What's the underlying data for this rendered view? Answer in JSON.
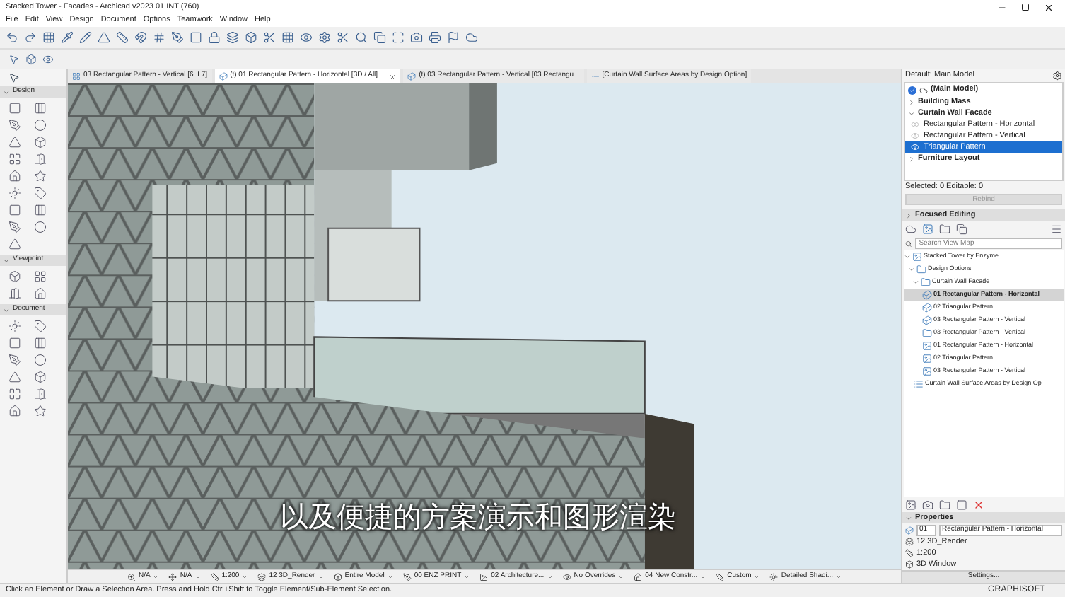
{
  "window": {
    "title": "Stacked Tower - Facades - Archicad v2023 01 INT (760)"
  },
  "menu": [
    "File",
    "Edit",
    "View",
    "Design",
    "Document",
    "Options",
    "Teamwork",
    "Window",
    "Help"
  ],
  "tabs": [
    {
      "label": "03 Rectangular Pattern - Vertical [6. L7]",
      "kind": "plan",
      "selected": false
    },
    {
      "label": "(t) 01 Rectangular Pattern - Horizontal [3D / All]",
      "kind": "view3d",
      "selected": true
    },
    {
      "label": "(t) 03 Rectangular Pattern - Vertical [03 Rectangu...",
      "kind": "view3d",
      "selected": false
    },
    {
      "label": "[Curtain Wall Surface Areas by Design Option]",
      "kind": "list",
      "selected": false
    }
  ],
  "toolbox": [
    {
      "title": "Design",
      "expanded": true
    },
    {
      "title": "Viewpoint",
      "expanded": true
    },
    {
      "title": "Document",
      "expanded": true
    }
  ],
  "subtitle": "以及便捷的方案演示和图形渲染",
  "view_bar": {
    "items": [
      {
        "label": "N/A",
        "kind": "zoom"
      },
      {
        "label": "N/A",
        "kind": "angle"
      },
      {
        "label": "1:200",
        "kind": "scale"
      },
      {
        "label": "12 3D_Render",
        "kind": "layers"
      },
      {
        "label": "Entire Model",
        "kind": "model"
      },
      {
        "label": "00 ENZ PRINT",
        "kind": "pen"
      },
      {
        "label": "02 Architecture...",
        "kind": "graphic"
      },
      {
        "label": "No Overrides",
        "kind": "override"
      },
      {
        "label": "04 New Constr...",
        "kind": "phase"
      },
      {
        "label": "Custom",
        "kind": "dimension"
      },
      {
        "label": "Detailed Shadi...",
        "kind": "shading"
      }
    ]
  },
  "status_bar": {
    "text": "Click an Element or Draw a Selection Area. Press and Hold Ctrl+Shift to Toggle Element/Sub-Element Selection.",
    "brand": "GRAPHISOFT"
  },
  "design_options": {
    "default": "Default: Main Model",
    "main": {
      "label": "(Main Model)",
      "checked": true
    },
    "sets": [
      {
        "label": "Building Mass",
        "expanded": false
      },
      {
        "label": "Curtain Wall Facade",
        "expanded": true,
        "options": [
          {
            "label": "Rectangular Pattern - Horizontal",
            "selected": false
          },
          {
            "label": "Rectangular Pattern - Vertical",
            "selected": false
          },
          {
            "label": "Triangular Pattern",
            "selected": true
          }
        ]
      },
      {
        "label": "Furniture Layout",
        "expanded": false
      }
    ],
    "selection": "Selected: 0 Editable: 0",
    "rebind": {
      "label": "Rebind",
      "disabled": true
    },
    "focused_editing": {
      "label": "Focused Editing",
      "expanded": false
    }
  },
  "navigator": {
    "search": {
      "placeholder": "Search View Map"
    },
    "tree": [
      {
        "label": "Stacked Tower by Enzyme",
        "kind": "project",
        "expanded": true,
        "selected": false,
        "children": [
          {
            "label": "Design Options",
            "kind": "folder",
            "expanded": true,
            "selected": false,
            "children": [
              {
                "label": "Curtain Wall Facade",
                "kind": "folder",
                "expanded": true,
                "selected": false,
                "children": [
                  {
                    "label": "01 Rectangular Pattern - Horizontal",
                    "kind": "view3d",
                    "selected": true
                  },
                  {
                    "label": "02 Triangular Pattern",
                    "kind": "view3d",
                    "selected": false
                  },
                  {
                    "label": "03 Rectangular Pattern - Vertical",
                    "kind": "view3d",
                    "selected": false
                  },
                  {
                    "label": "03 Rectangular Pattern - Vertical",
                    "kind": "folder",
                    "selected": false
                  },
                  {
                    "label": "01 Rectangular Pattern - Horizontal",
                    "kind": "elevation",
                    "selected": false
                  },
                  {
                    "label": "02 Triangular Pattern",
                    "kind": "elevation",
                    "selected": false
                  },
                  {
                    "label": "03 Rectangular Pattern - Vertical",
                    "kind": "elevation",
                    "selected": false
                  }
                ]
              }
            ]
          },
          {
            "label": "Curtain Wall Surface Areas by Design Op",
            "kind": "list",
            "selected": false
          }
        ]
      }
    ]
  },
  "properties": {
    "title": "Properties",
    "id": "01",
    "name": "Rectangular Pattern - Horizontal",
    "layers": "12 3D_Render",
    "scale": "1:200",
    "window": "3D Window",
    "settings": "Settings..."
  }
}
